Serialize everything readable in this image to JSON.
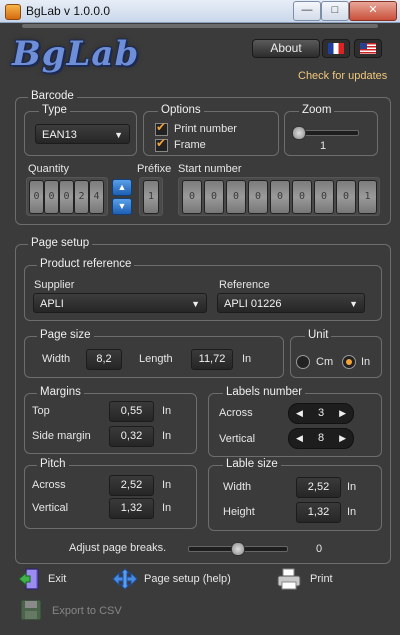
{
  "window": {
    "title": "BgLab v 1.0.0.0",
    "min": "—",
    "max": "□",
    "close": "✕"
  },
  "header": {
    "logo": "BgLab",
    "about": "About",
    "check_updates": "Check for updates"
  },
  "barcode": {
    "title": "Barcode",
    "type_title": "Type",
    "type_value": "EAN13",
    "options_title": "Options",
    "opt_print_number": "Print number",
    "opt_frame": "Frame",
    "zoom_title": "Zoom",
    "zoom_value": "1",
    "quantity_label": "Quantity",
    "quantity_digits": [
      "0",
      "0",
      "0",
      "2",
      "4"
    ],
    "prefix_label": "Préfixe",
    "prefix_value": "1",
    "start_label": "Start number",
    "start_digits": [
      "0",
      "0",
      "0",
      "0",
      "0",
      "0",
      "0",
      "0",
      "1"
    ]
  },
  "page_setup": {
    "title": "Page setup",
    "product_ref_title": "Product reference",
    "supplier_label": "Supplier",
    "supplier_value": "APLI",
    "reference_label": "Reference",
    "reference_value": "APLI 01226",
    "page_size_title": "Page size",
    "width_label": "Width",
    "width_value": "8,2",
    "length_label": "Length",
    "length_value": "11,72",
    "length_unit": "In",
    "unit_title": "Unit",
    "unit_cm": "Cm",
    "unit_in": "In",
    "margins_title": "Margins",
    "top_label": "Top",
    "top_value": "0,55",
    "side_label": "Side margin",
    "side_value": "0,32",
    "margins_unit": "In",
    "labels_number_title": "Labels number",
    "across_label": "Across",
    "across_value": "3",
    "vertical_label": "Vertical",
    "vertical_value": "8",
    "pitch_title": "Pitch",
    "pitch_across_label": "Across",
    "pitch_across_value": "2,52",
    "pitch_vertical_label": "Vertical",
    "pitch_vertical_value": "1,32",
    "pitch_unit": "In",
    "label_size_title": "Lable size",
    "ls_width_label": "Width",
    "ls_width_value": "2,52",
    "ls_height_label": "Height",
    "ls_height_value": "1,32",
    "ls_unit": "In",
    "adjust_label": "Adjust page breaks.",
    "adjust_value": "0"
  },
  "actions": {
    "exit": "Exit",
    "page_setup_help": "Page setup (help)",
    "print": "Print",
    "export_csv": "Export to CSV"
  },
  "colors": {
    "accent": "#f2a33a",
    "update_link": "#f1c97c",
    "logo": "#6e8fd8"
  }
}
